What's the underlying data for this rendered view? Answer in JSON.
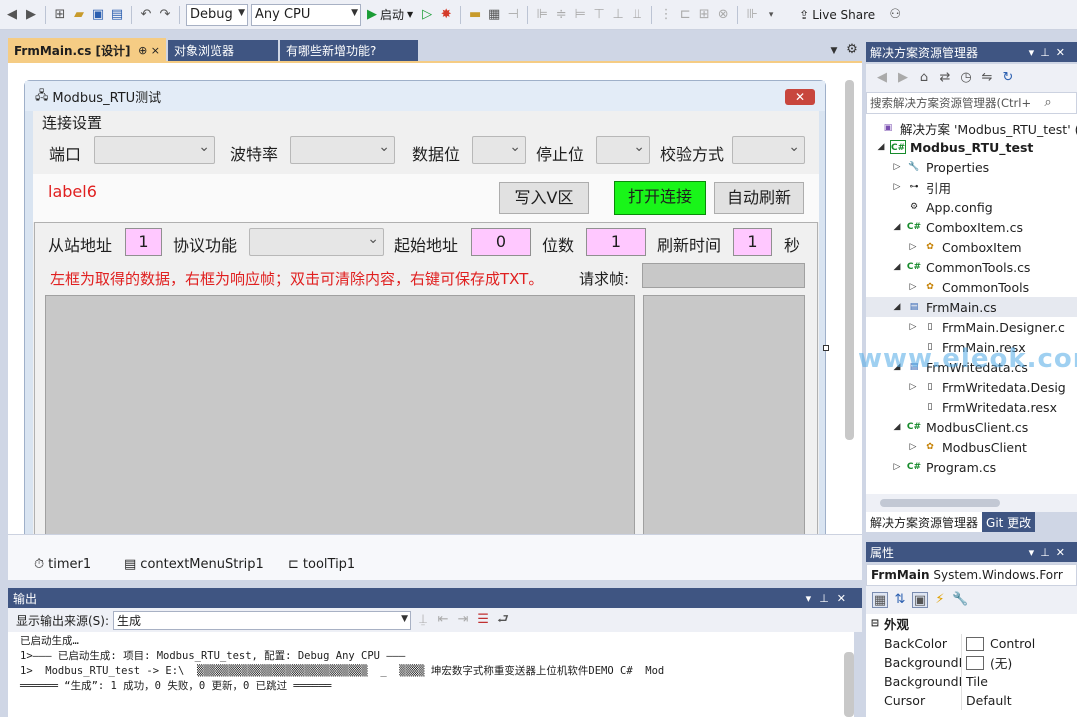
{
  "toolbar": {
    "config": "Debug",
    "platform": "Any CPU",
    "start_label": "启动",
    "live_share": "Live Share"
  },
  "doc_tabs": [
    {
      "label": "FrmMain.cs [设计]",
      "pin": "⊕ ×"
    },
    {
      "label": "对象浏览器"
    },
    {
      "label": "有哪些新增功能?"
    }
  ],
  "form": {
    "title": "Modbus_RTU测试",
    "conn_group": "连接设置",
    "port": "端口",
    "baud": "波特率",
    "databits": "数据位",
    "stopbits": "停止位",
    "parity": "校验方式",
    "label6": "label6",
    "btn_write": "写入V区",
    "btn_open": "打开连接",
    "btn_refresh": "自动刷新",
    "slave_addr": "从站地址",
    "slave_val": "1",
    "func": "协议功能",
    "start_addr": "起始地址",
    "start_val": "0",
    "bits": "位数",
    "bits_val": "1",
    "refresh_time": "刷新时间",
    "refresh_val": "1",
    "sec": "秒",
    "hint": "左框为取得的数据，右框为响应帧；双击可清除内容，右键可保存成TXT。",
    "req_frame": "请求帧:"
  },
  "tray": [
    "timer1",
    "contextMenuStrip1",
    "toolTip1"
  ],
  "output": {
    "title": "输出",
    "source_label": "显示输出来源(S):",
    "source_value": "生成",
    "lines": [
      "已启动生成…",
      "1>——— 已启动生成: 项目: Modbus_RTU_test, 配置: Debug Any CPU ———",
      "1>  Modbus_RTU_test -> E:\\  ▒▒▒▒▒▒▒▒▒▒▒▒▒▒▒▒▒▒▒▒▒▒▒▒▒▒▒  _  ▒▒▒▒ 坤宏数字式称重变送器上位机软件DEMO C#  Mod",
      "══════ “生成”: 1 成功，0 失败，0 更新，0 已跳过 ══════"
    ]
  },
  "solution": {
    "title": "解决方案资源管理器",
    "search_placeholder": "搜索解决方案资源管理器(Ctrl+",
    "items": [
      {
        "label": "解决方案 'Modbus_RTU_test' (",
        "icon": "solution-icon"
      },
      {
        "label": "Modbus_RTU_test",
        "icon": "csproj-icon"
      },
      {
        "label": "Properties",
        "icon": "wrench-icon"
      },
      {
        "label": "引用",
        "icon": "reference-icon"
      },
      {
        "label": "App.config",
        "icon": "config-icon"
      },
      {
        "label": "ComboxItem.cs",
        "icon": "cs-icon"
      },
      {
        "label": "ComboxItem",
        "icon": "class-icon"
      },
      {
        "label": "CommonTools.cs",
        "icon": "cs-icon"
      },
      {
        "label": "CommonTools",
        "icon": "class-icon"
      },
      {
        "label": "FrmMain.cs",
        "icon": "form-icon"
      },
      {
        "label": "FrmMain.Designer.c",
        "icon": "file-icon"
      },
      {
        "label": "FrmMain.resx",
        "icon": "file-icon"
      },
      {
        "label": "FrmWritedata.cs",
        "icon": "form-icon"
      },
      {
        "label": "FrmWritedata.Desig",
        "icon": "file-icon"
      },
      {
        "label": "FrmWritedata.resx",
        "icon": "file-icon"
      },
      {
        "label": "ModbusClient.cs",
        "icon": "cs-icon"
      },
      {
        "label": "ModbusClient",
        "icon": "class-icon"
      },
      {
        "label": "Program.cs",
        "icon": "cs-icon"
      }
    ],
    "tabs": [
      "解决方案资源管理器",
      "Git 更改"
    ]
  },
  "properties": {
    "title": "属性",
    "object": "FrmMain",
    "object_type": "System.Windows.Forr",
    "category": "外观",
    "rows": [
      {
        "name": "BackColor",
        "value": "Control"
      },
      {
        "name": "BackgroundI",
        "value": "(无)"
      },
      {
        "name": "BackgroundI",
        "value": "Tile"
      },
      {
        "name": "Cursor",
        "value": "Default"
      }
    ]
  },
  "watermark": "www.eleok.com"
}
